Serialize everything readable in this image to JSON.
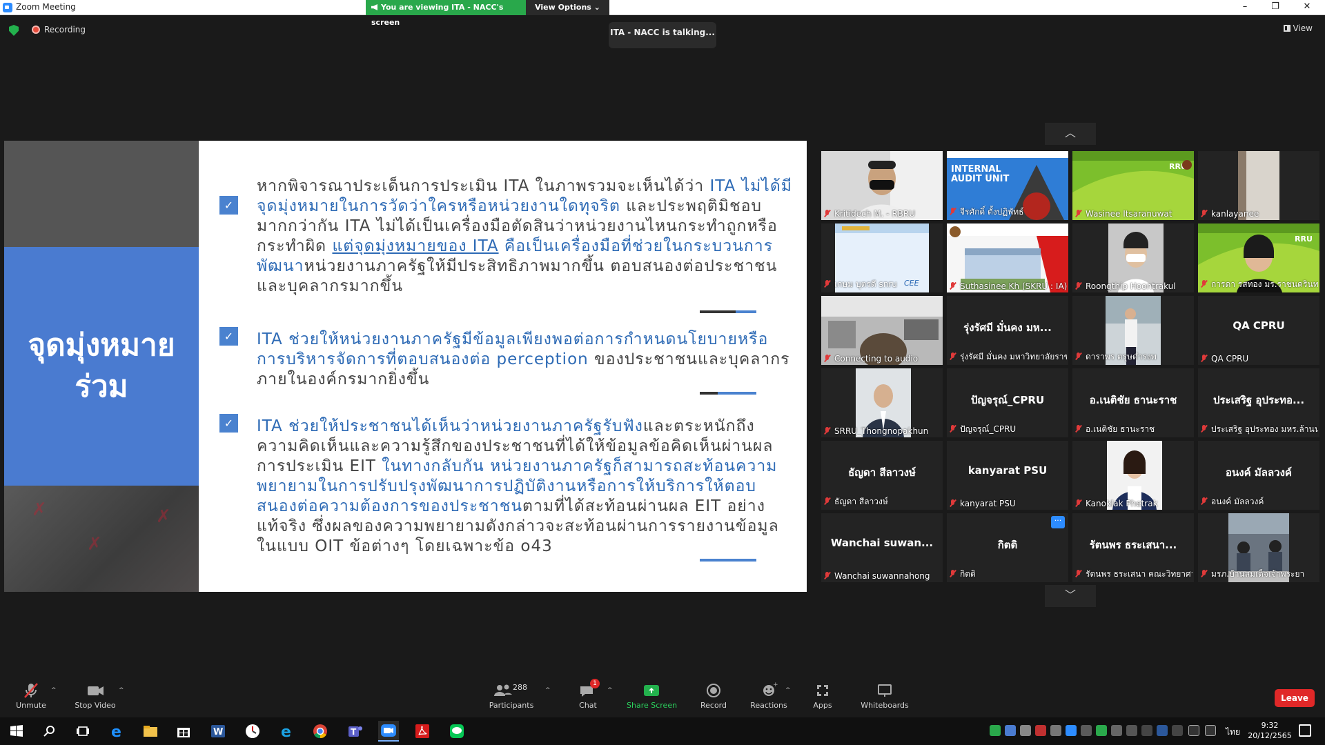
{
  "window": {
    "title": "Zoom Meeting"
  },
  "share_banner": {
    "viewing": "You are viewing ITA - NACC's screen",
    "view_options": "View Options"
  },
  "status": {
    "recording": "Recording",
    "talking": "ITA - NACC is talking...",
    "view": "View"
  },
  "slide": {
    "left_title_line1": "จุดมุ่งหมาย",
    "left_title_line2": "ร่วม",
    "p1": [
      {
        "t": "หากพิจารณาประเด็นการประเมิน ITA ในภาพรวมจะเห็นได้ว่า ",
        "s": "n"
      },
      {
        "t": "ITA ไม่ได้มีจุดมุ่งหมายในการวัดว่าใครหรือหน่วยงานใดทุจริต",
        "s": "h"
      },
      {
        "t": " และประพฤติมิชอบมากกว่ากัน ITA ไม่ได้เป็นเครื่องมือตัดสินว่าหน่วยงานไหนกระทำถูกหรือกระทำผิด ",
        "s": "n"
      },
      {
        "t": "แต่จุดมุ่งหมายของ ITA",
        "s": "u"
      },
      {
        "t": " คือเป็นเครื่องมือที่ช่วยในกระบวนการพัฒนา",
        "s": "h"
      },
      {
        "t": "หน่วยงานภาครัฐให้มีประสิทธิภาพมากขึ้น ตอบสนองต่อประชาชนและบุคลากรมากขึ้น",
        "s": "n"
      }
    ],
    "p2": [
      {
        "t": "ITA ช่วยให้หน่วยงานภาครัฐมีข้อมูลเพียงพอต่อการกำหนดนโยบายหรือการบริหารจัดการที่ตอบสนองต่อ perception",
        "s": "h"
      },
      {
        "t": " ของประชาชนและบุคลากรภายในองค์กรมากยิ่งขึ้น",
        "s": "n"
      }
    ],
    "p3": [
      {
        "t": "ITA ช่วยให้ประชาชนได้เห็นว่าหน่วยงานภาครัฐรับฟัง",
        "s": "h"
      },
      {
        "t": "และตระหนักถึงความคิดเห็นและความรู้สึกของประชาชนที่ได้ให้ข้อมูลข้อคิดเห็นผ่านผลการประเมิน EIT ",
        "s": "n"
      },
      {
        "t": "ในทางกลับกัน หน่วยงานภาครัฐก็สามารถสะท้อนความพยายามในการปรับปรุงพัฒนาการปฏิบัติงานหรือการให้บริการให้ตอบสนองต่อความต้องการของประชาชน",
        "s": "h"
      },
      {
        "t": "ตามที่ได้สะท้อนผ่านผล EIT อย่างแท้จริง ซึ่งผลของความพยายามดังกล่าวจะสะท้อนผ่านการรายงานข้อมูลในแบบ OIT ข้อต่างๆ โดยเฉพาะข้อ o43",
        "s": "n"
      }
    ]
  },
  "gallery": [
    {
      "label": "Kritidech M. - RBRU",
      "center": "",
      "video": "person-mask"
    },
    {
      "label": "จีรศักดิ์ ตั้งปฏิพัทธ์",
      "center": "",
      "video": "audit-banner",
      "overlay": "INTERNAL AUDIT UNIT"
    },
    {
      "label": "Wasinee Itsaranuwat",
      "center": "",
      "video": "green-banner",
      "overlay": "RRU"
    },
    {
      "label": "kanlayanee",
      "center": "",
      "video": "wall"
    },
    {
      "label": "เกษม บุตรดี snru",
      "center": "",
      "video": "blue-slide"
    },
    {
      "label": "Suthasinee Kh (SKRU : IA)",
      "center": "",
      "video": "building"
    },
    {
      "label": "Roongthip Hoontrakul",
      "center": "",
      "video": "person-mask-w"
    },
    {
      "label": "การดา รสทอง มร.ราชนครินทร์",
      "center": "",
      "video": "green-person",
      "overlay": "RRU"
    },
    {
      "label": "Connecting to audio",
      "center": "",
      "video": "office"
    },
    {
      "label": "รุ่งรัศมี มั่นคง มหาวิทยาลัยราชภัฏ",
      "center": "รุ่งรัศมี มั่นคง มห...",
      "video": ""
    },
    {
      "label": "ดาราพร ตรุษดำรงพ",
      "center": "",
      "video": "standing"
    },
    {
      "label": "QA CPRU",
      "center": "QA CPRU",
      "video": ""
    },
    {
      "label": "SRRU_Thongnopakhun",
      "center": "",
      "video": "man-suit"
    },
    {
      "label": "ปัญจรุณ์_CPRU",
      "center": "ปัญจรุณ์_CPRU",
      "video": ""
    },
    {
      "label": "อ.เนติชัย ธานะราช",
      "center": "อ.เนติชัย ธานะราช",
      "video": ""
    },
    {
      "label": "ประเสริฐ อุประทอง มหร.ล้านนา",
      "center": "ประเสริฐ อุประทอ...",
      "video": ""
    },
    {
      "label": "ธัญดา สีลาวงษ์",
      "center": "ธัญดา สีลาวงษ์",
      "video": ""
    },
    {
      "label": "kanyarat PSU",
      "center": "kanyarat PSU",
      "video": ""
    },
    {
      "label": "Kanoklak Phetrak",
      "center": "",
      "video": "woman-suit"
    },
    {
      "label": "อนงค์ มัลลวงค์",
      "center": "อนงค์ มัลลวงค์",
      "video": ""
    },
    {
      "label": "Wanchai suwannahong",
      "center": "Wanchai suwan...",
      "video": ""
    },
    {
      "label": "กิตติ",
      "center": "กิตติ",
      "video": ""
    },
    {
      "label": "รัตนพร ธระเสนา คณะวิทยาศาสตร์",
      "center": "รัตนพร ธระเสนา...",
      "video": ""
    },
    {
      "label": "มรภ.บ้านสมเด็จเจ้าพระยา",
      "center": "",
      "video": "group"
    }
  ],
  "toolbar": {
    "unmute": "Unmute",
    "stop_video": "Stop Video",
    "participants": "Participants",
    "participants_count": "288",
    "chat": "Chat",
    "chat_badge": "1",
    "share_screen": "Share Screen",
    "record": "Record",
    "reactions": "Reactions",
    "apps": "Apps",
    "whiteboards": "Whiteboards",
    "leave": "Leave"
  },
  "taskbar": {
    "time": "9:32",
    "date": "20/12/2565",
    "ime": "ไทย"
  },
  "colors": {
    "zoom_blue": "#2d8cff",
    "share_green": "#29a84b",
    "leave_red": "#e02828",
    "slide_blue": "#4a7bd0"
  }
}
